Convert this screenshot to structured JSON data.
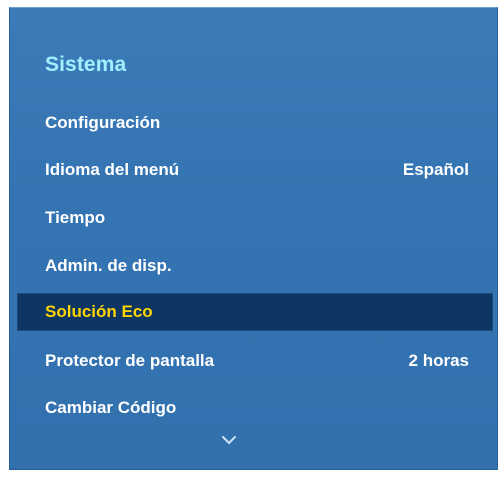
{
  "menu": {
    "title": "Sistema",
    "items": [
      {
        "label": "Configuración",
        "value": ""
      },
      {
        "label": "Idioma del menú",
        "value": "Español"
      },
      {
        "label": "Tiempo",
        "value": ""
      },
      {
        "label": "Admin. de disp.",
        "value": ""
      },
      {
        "label": "Solución Eco",
        "value": ""
      },
      {
        "label": "Protector de pantalla",
        "value": "2 horas"
      },
      {
        "label": "Cambiar Código",
        "value": ""
      }
    ],
    "selected_index": 4,
    "scroll_indicator": "chevron-down-icon"
  },
  "colors": {
    "panel": "#3574b2",
    "title": "#9ff0ff",
    "selected_background": "#0d3665",
    "selected_text": "#ffd400",
    "text": "#ffffff"
  }
}
